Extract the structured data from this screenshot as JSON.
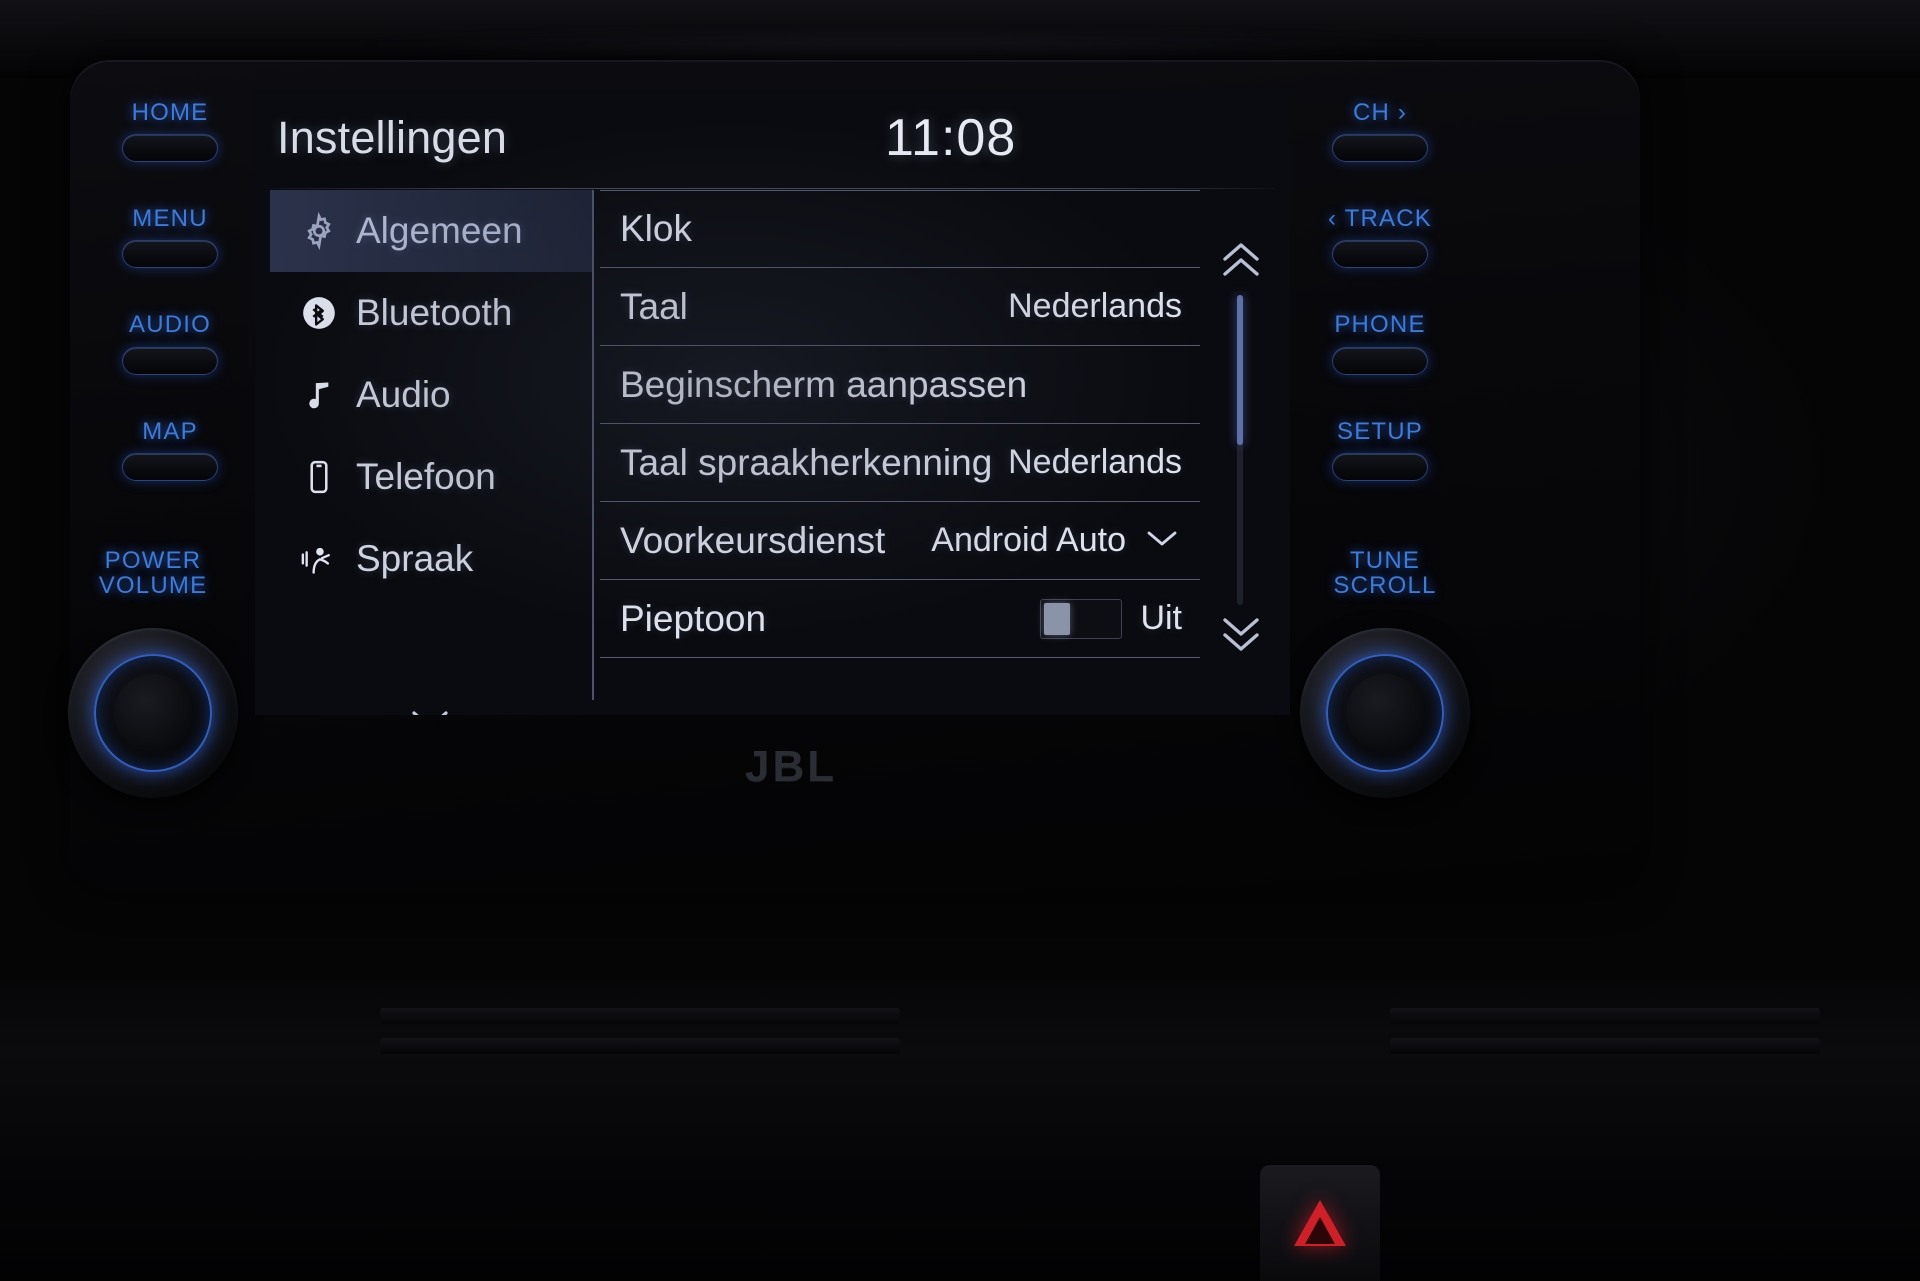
{
  "screen": {
    "title": "Instellingen",
    "clock": "11:08",
    "sidebar": [
      {
        "label": "Algemeen",
        "icon": "gear-icon",
        "selected": true
      },
      {
        "label": "Bluetooth",
        "icon": "bluetooth-icon",
        "selected": false
      },
      {
        "label": "Audio",
        "icon": "music-note-icon",
        "selected": false
      },
      {
        "label": "Telefoon",
        "icon": "phone-icon",
        "selected": false
      },
      {
        "label": "Spraak",
        "icon": "voice-icon",
        "selected": false
      }
    ],
    "sidebar_more_icon": "chevron-down-icon",
    "settings_rows": [
      {
        "label": "Klok",
        "value": "",
        "control": "none"
      },
      {
        "label": "Taal",
        "value": "Nederlands",
        "control": "none"
      },
      {
        "label": "Beginscherm aanpassen",
        "value": "",
        "control": "none"
      },
      {
        "label": "Taal spraakherkenning",
        "value": "Nederlands",
        "control": "none"
      },
      {
        "label": "Voorkeursdienst",
        "value": "Android Auto",
        "control": "dropdown"
      },
      {
        "label": "Pieptoon",
        "value": "Uit",
        "control": "toggle"
      }
    ],
    "scroll": {
      "up_icon": "double-chevron-up-icon",
      "down_icon": "double-chevron-down-icon"
    }
  },
  "hardkeys": {
    "left": [
      {
        "label": "HOME"
      },
      {
        "label": "MENU"
      },
      {
        "label": "AUDIO"
      },
      {
        "label": "MAP"
      }
    ],
    "right": [
      {
        "label": "CH ›"
      },
      {
        "label": "‹ TRACK"
      },
      {
        "label": "PHONE"
      },
      {
        "label": "SETUP"
      }
    ],
    "left_knob_caption": "POWER\nVOLUME",
    "right_knob_caption": "TUNE\nSCROLL"
  },
  "brand": {
    "speaker_logo": "JBL"
  },
  "colors": {
    "key_blue": "#3b7bdc",
    "screen_text": "#dfe3ee",
    "selection_bg": "#2e3650",
    "scroll_thumb": "#5f6fa8",
    "hazard_red": "#d01f26"
  }
}
